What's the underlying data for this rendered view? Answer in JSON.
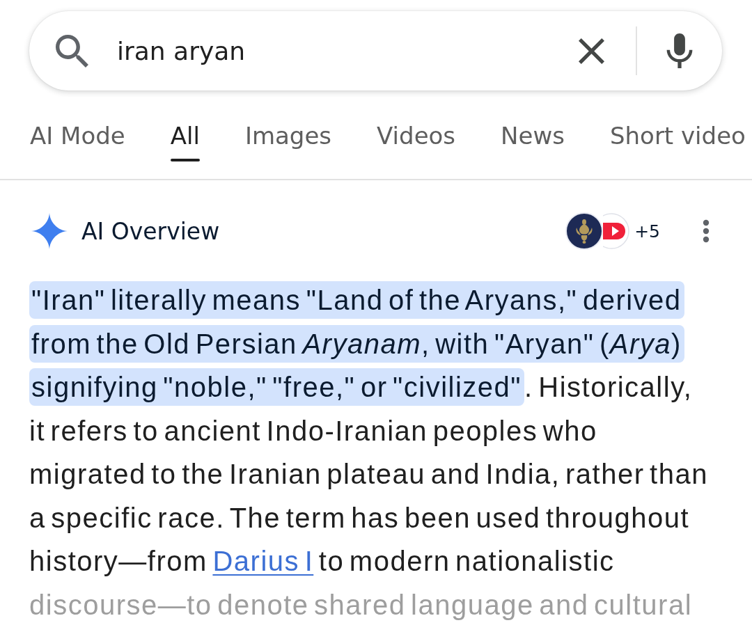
{
  "search": {
    "value": "iran aryan"
  },
  "tabs": [
    {
      "label": "AI Mode",
      "selected": false
    },
    {
      "label": "All",
      "selected": true
    },
    {
      "label": "Images",
      "selected": false
    },
    {
      "label": "Videos",
      "selected": false
    },
    {
      "label": "News",
      "selected": false
    },
    {
      "label": "Short video",
      "selected": false
    }
  ],
  "overview": {
    "title": "AI Overview",
    "source_count": "+5",
    "segments": [
      {
        "kind": "text",
        "text": "\"Iran\" literally means \"Land of the Aryans,\" derived from the Old Persian *Aryanam*, with \"Aryan\" (*Arya*) signifying \"noble,\" \"free,\" or \"civilized\"",
        "highlighted": true,
        "faded": false
      },
      {
        "kind": "text",
        "text": ". Historically, it refers to ancient Indo-Iranian peoples who migrated to the Iranian plateau and India, rather than a specific race. The term has been used throughout history—from ",
        "highlighted": false,
        "faded": false
      },
      {
        "kind": "link",
        "text": "Darius I",
        "highlighted": false,
        "faded": false
      },
      {
        "kind": "text",
        "text": " to modern nationalistic ",
        "highlighted": false,
        "faded": false
      },
      {
        "kind": "text",
        "text": "discourse—to denote shared language and cultural",
        "highlighted": false,
        "faded": true
      }
    ]
  }
}
